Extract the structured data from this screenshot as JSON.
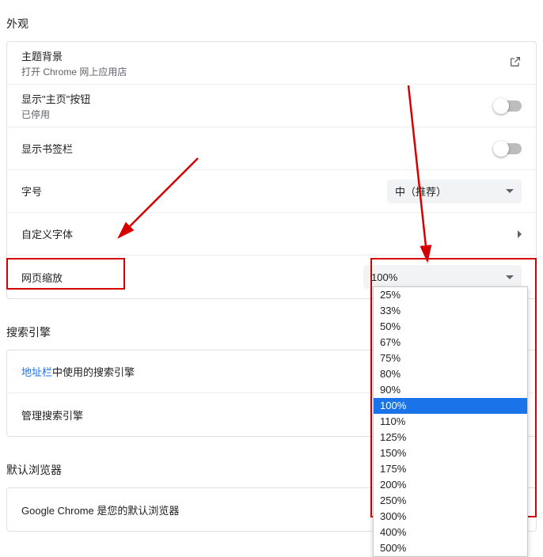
{
  "appearance": {
    "header": "外观",
    "theme_title": "主题背景",
    "theme_sub": "打开 Chrome 网上应用店",
    "home_button_title": "显示\"主页\"按钮",
    "home_button_sub": "已停用",
    "bookmark_bar_title": "显示书签栏",
    "font_size_title": "字号",
    "font_size_value": "中（推荐）",
    "custom_fonts_title": "自定义字体",
    "page_zoom_title": "网页缩放",
    "page_zoom_value": "100%",
    "zoom_options": [
      "25%",
      "33%",
      "50%",
      "67%",
      "75%",
      "80%",
      "90%",
      "100%",
      "110%",
      "125%",
      "150%",
      "175%",
      "200%",
      "250%",
      "300%",
      "400%",
      "500%"
    ],
    "zoom_selected": "100%"
  },
  "search": {
    "header": "搜索引擎",
    "row1_prefix": "地址栏",
    "row1_suffix": "中使用的搜索引擎",
    "row2": "管理搜索引擎"
  },
  "default_browser": {
    "header": "默认浏览器",
    "text": "Google Chrome 是您的默认浏览器"
  }
}
